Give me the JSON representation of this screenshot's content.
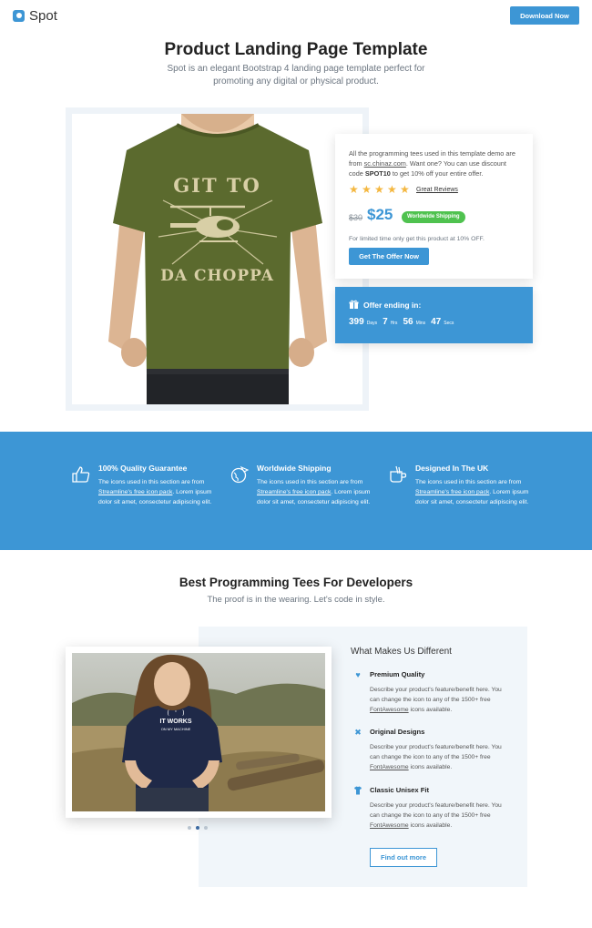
{
  "nav": {
    "brand": "Spot",
    "download_label": "Download Now"
  },
  "hero": {
    "title": "Product Landing Page Template",
    "subtitle": "Spot is an elegant Bootstrap 4 landing page template perfect for promoting any digital or physical product."
  },
  "product": {
    "shirt_text_top": "GIT TO",
    "shirt_text_bottom": "DA CHOPPA",
    "shirt_color": "#5b6a2e"
  },
  "offer": {
    "text_before_link": "All the programming tees used in this template demo are from ",
    "link": "sc.chinaz.com",
    "text_mid": ". Want one? You can use discount code ",
    "code": "SPOT10",
    "text_after": " to get 10% off your entire offer.",
    "rating": 5,
    "reviews_label": "Great Reviews",
    "old_price": "$30",
    "new_price": "$25",
    "shipping_badge": "Worldwide Shipping",
    "limited_text": "For limited time only get this product at 10% OFF.",
    "cta_label": "Get The Offer Now"
  },
  "countdown": {
    "title": "Offer ending in:",
    "days": "399",
    "days_label": "Days",
    "hours": "7",
    "hours_label": "Hrs",
    "mins": "56",
    "mins_label": "Mins",
    "secs": "47",
    "secs_label": "Secs"
  },
  "features": [
    {
      "icon": "thumbs-up-icon",
      "title": "100% Quality Guarantee",
      "desc_before": "The icons used in this section are from ",
      "link": "Streamline's free icon pack",
      "desc_after": ". Lorem ipsum dolor sit amet, consectetur adipiscing elit."
    },
    {
      "icon": "globe-plane-icon",
      "title": "Worldwide Shipping",
      "desc_before": "The icons used in this section are from ",
      "link": "Streamline's free icon pack",
      "desc_after": ". Lorem ipsum dolor sit amet, consectetur adipiscing elit."
    },
    {
      "icon": "tea-cup-icon",
      "title": "Designed In The UK",
      "desc_before": "The icons used in this section are from ",
      "link": "Streamline's free icon pack",
      "desc_after": ". Lorem ipsum dolor sit amet, consectetur adipiscing elit."
    }
  ],
  "section2": {
    "title": "Best Programming Tees For Developers",
    "subtitle": "The proof is in the wearing. Let's code in style.",
    "photo_shirt_text_1": "( ' )",
    "photo_shirt_text_2": "IT WORKS",
    "photo_shirt_text_3": "ON MY MACHINE",
    "carousel_active": 1,
    "diff_title": "What Makes Us Different",
    "items": [
      {
        "icon": "heart-icon",
        "name": "Premium Quality",
        "desc_before": "Describe your product's feature/benefit here. You can change the icon to any of the 1500+ free ",
        "link": "FontAwesome",
        "desc_after": " icons available."
      },
      {
        "icon": "crossed-tools-icon",
        "name": "Original Designs",
        "desc_before": "Describe your product's feature/benefit here. You can change the icon to any of the 1500+ free ",
        "link": "FontAwesome",
        "desc_after": " icons available."
      },
      {
        "icon": "tshirt-icon",
        "name": "Classic Unisex Fit",
        "desc_before": "Describe your product's feature/benefit here. You can change the icon to any of the 1500+ free ",
        "link": "FontAwesome",
        "desc_after": " icons available."
      }
    ],
    "more_label": "Find out more"
  },
  "colors": {
    "accent": "#3d96d5",
    "badge_green": "#4fc24f",
    "star": "#f4b740",
    "panel": "#f1f6fa"
  }
}
